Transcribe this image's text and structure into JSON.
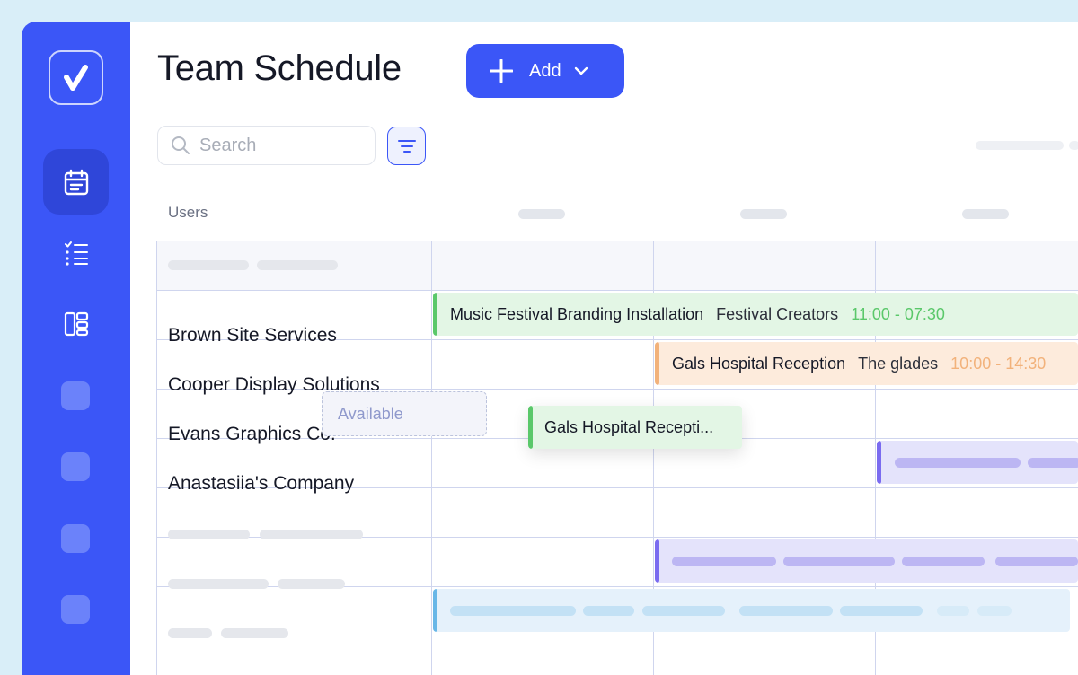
{
  "header": {
    "title": "Team Schedule",
    "add_label": "Add"
  },
  "search": {
    "placeholder": "Search"
  },
  "table": {
    "users_header": "Users",
    "rows": [
      {
        "name": "Brown Site Services"
      },
      {
        "name": "Cooper Display Solutions"
      },
      {
        "name": "Evans Graphics Co."
      },
      {
        "name": "Anastasiia's Company"
      }
    ]
  },
  "events": [
    {
      "title": "Music Festival Branding Installation",
      "client": "Festival Creators",
      "time": "11:00 - 07:30",
      "color": "#5ac86a",
      "time_color": "#5ac86a"
    },
    {
      "title": "Gals Hospital Reception",
      "client": "The glades",
      "time": "10:00 - 14:30",
      "color": "#f2b27b",
      "time_color": "#f2b27b"
    }
  ],
  "available_label": "Available",
  "drag_card": {
    "title": "Gals Hospital Recepti..."
  },
  "colors": {
    "brand": "#3b56f7",
    "green_bg": "#e3f6e5",
    "orange_bg": "#fdebdc",
    "purple_bg": "#e4e3fb",
    "blue_bg": "#e5f1fb"
  }
}
